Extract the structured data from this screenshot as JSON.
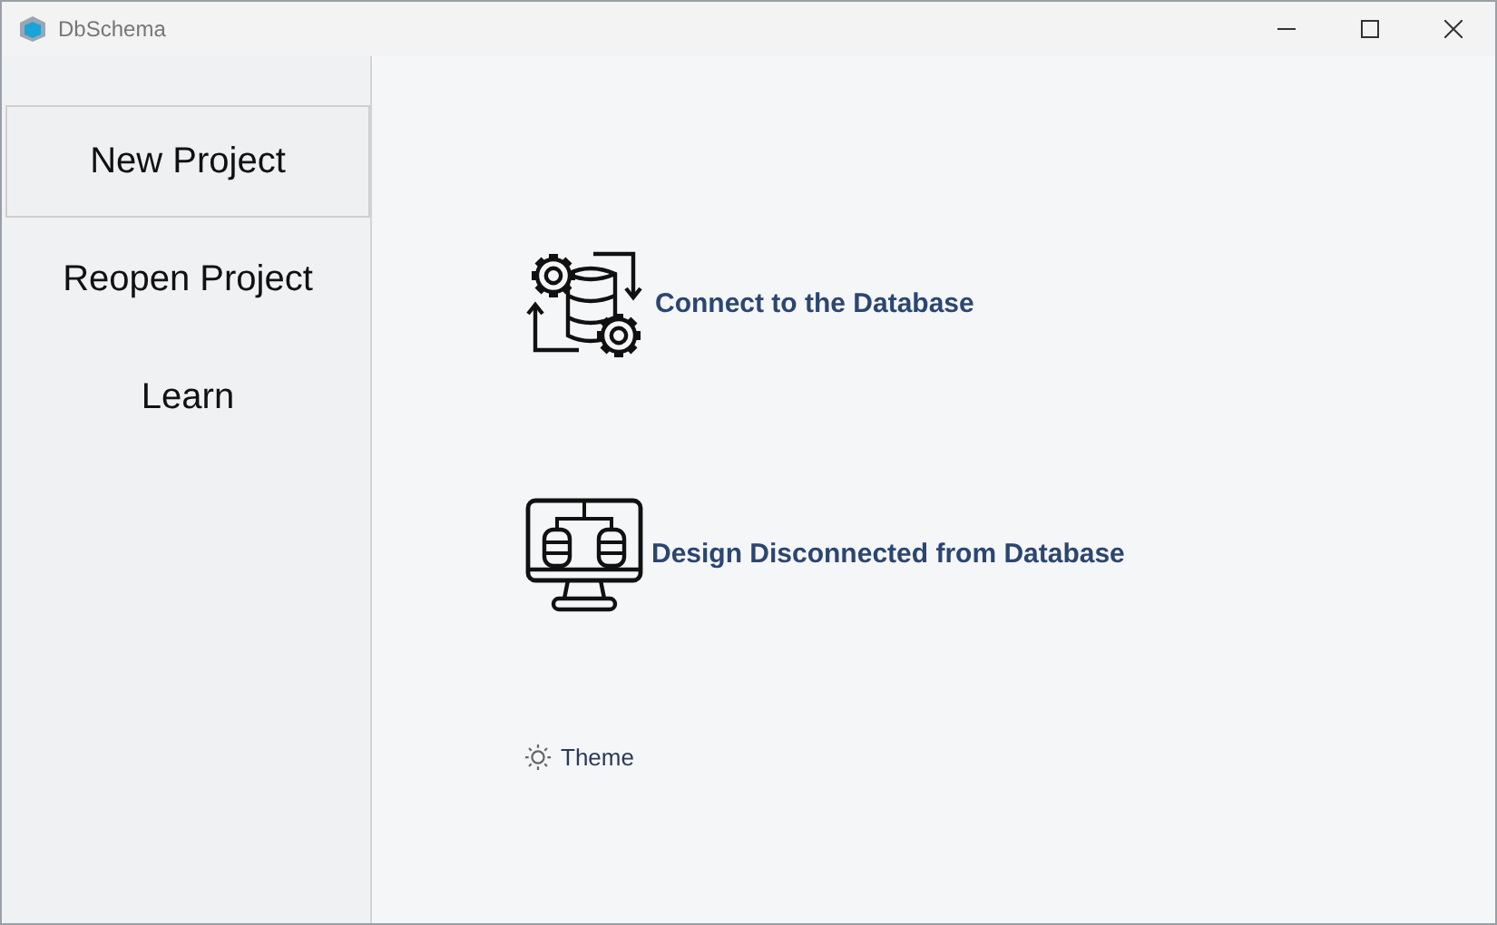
{
  "window": {
    "title": "DbSchema"
  },
  "sidebar": {
    "items": [
      {
        "label": "New Project",
        "selected": true
      },
      {
        "label": "Reopen Project",
        "selected": false
      },
      {
        "label": "Learn",
        "selected": false
      }
    ]
  },
  "actions": [
    {
      "kind": "connect",
      "label": "Connect to the Database"
    },
    {
      "kind": "design",
      "label": "Design Disconnected from Database"
    }
  ],
  "theme": {
    "label": "Theme"
  }
}
